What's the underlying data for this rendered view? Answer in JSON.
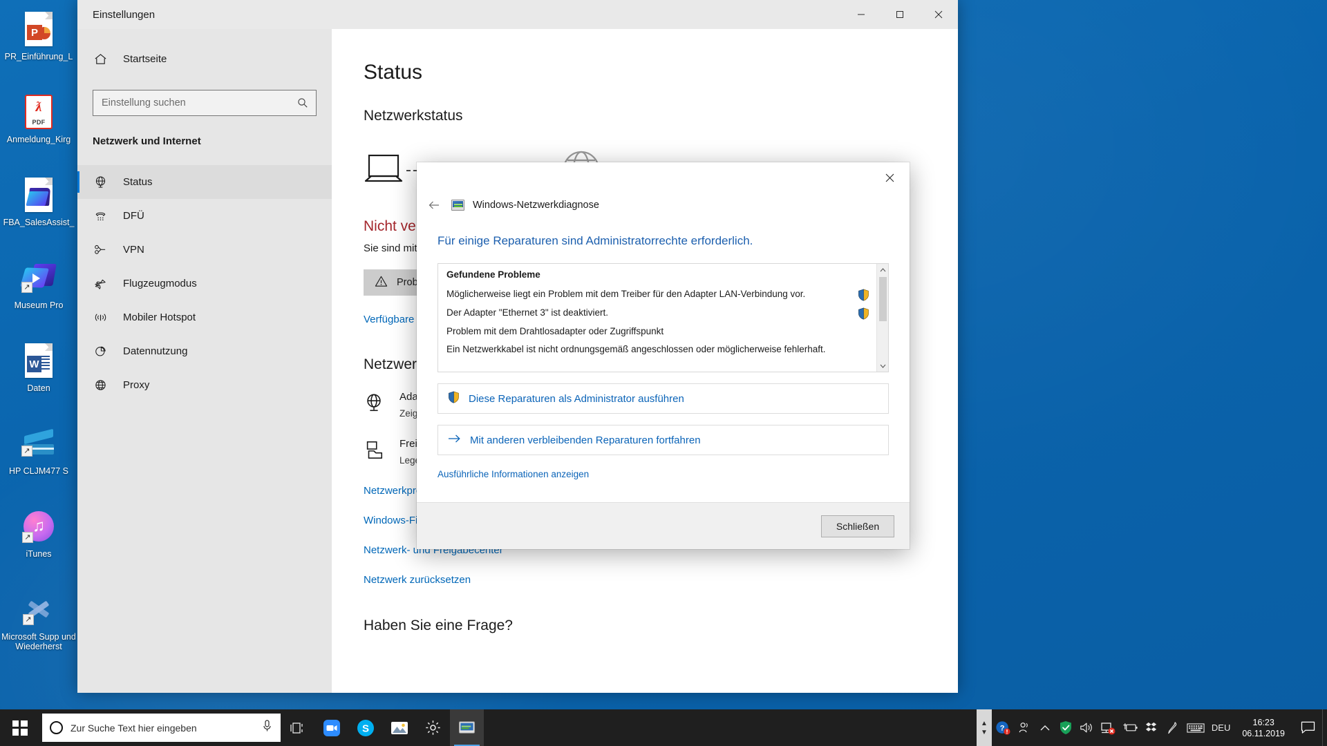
{
  "desktop": {
    "icons": [
      {
        "label": "PR_Einführung_L",
        "type": "powerpoint-file",
        "icon": "powerpoint-icon"
      },
      {
        "label": "Anmeldung_Kirg",
        "type": "pdf-file",
        "icon": "pdf-icon"
      },
      {
        "label": "FBA_SalesAssist_",
        "type": "folder-file",
        "icon": "blue-folder-icon"
      },
      {
        "label": "Museum Pro",
        "type": "shortcut",
        "icon": "museum-pro-icon"
      },
      {
        "label": "Daten",
        "type": "word-file",
        "icon": "word-icon"
      },
      {
        "label": "HP CLJM477 S",
        "type": "shortcut",
        "icon": "scanner-icon"
      },
      {
        "label": "iTunes",
        "type": "shortcut",
        "icon": "itunes-icon"
      },
      {
        "label": "Microsoft Supp und Wiederherst",
        "type": "shortcut",
        "icon": "support-recovery-icon"
      }
    ]
  },
  "settings_window": {
    "title": "Einstellungen",
    "titlebar": {
      "minimize_label": "─",
      "maximize_label": "□",
      "close_label": "✕"
    },
    "sidebar": {
      "home_label": "Startseite",
      "search": {
        "placeholder": "Einstellung suchen",
        "value": "",
        "icon": "search-icon"
      },
      "heading": "Netzwerk und Internet",
      "items": [
        {
          "label": "Status",
          "icon": "globe-icon",
          "active": true
        },
        {
          "label": "DFÜ",
          "icon": "dialup-phone-icon",
          "active": false
        },
        {
          "label": "VPN",
          "icon": "vpn-icon",
          "active": false
        },
        {
          "label": "Flugzeugmodus",
          "icon": "airplane-icon",
          "active": false
        },
        {
          "label": "Mobiler Hotspot",
          "icon": "hotspot-icon",
          "active": false
        },
        {
          "label": "Datennutzung",
          "icon": "pie-chart-icon",
          "active": false
        },
        {
          "label": "Proxy",
          "icon": "globe-icon",
          "active": false
        }
      ]
    },
    "main": {
      "page_title": "Status",
      "section_title": "Netzwerkstatus",
      "status_headline": "Nicht verbunden",
      "status_sub": "Sie sind mit keinem Netzwerk verbunden.",
      "troubleshoot_button": "Probleme behandeln",
      "troubleshoot_icon": "warning-icon",
      "available_networks_link": "Verfügbare Netzwerke anzeigen",
      "settings_section_title": "Netzwerkeinstellungen ändern",
      "settings_rows": [
        {
          "title": "Adapteroptionen ändern",
          "desc": "Zeigen Sie Netzwerkadapter an und ändern Sie die Verbindungseinstellungen.",
          "icon": "network-adapter-icon"
        },
        {
          "title": "Freigabeoptionen",
          "desc": "Legen Sie fest, was für die Netzwerke freigegeben werden soll, mit denen Sie eine Verbindung herstellen.",
          "icon": "sharing-icon"
        }
      ],
      "footer_links": [
        "Netzwerkproblembehandlung",
        "Windows-Firewall",
        "Netzwerk- und Freigabecenter",
        "Netzwerk zurücksetzen"
      ],
      "question_title": "Haben Sie eine Frage?"
    }
  },
  "diagnose_dialog": {
    "app_title": "Windows-Netzwerkdiagnose",
    "app_icon": "network-diagnostics-icon",
    "back_icon": "back-arrow-icon",
    "close_icon": "close-icon",
    "heading": "Für einige Reparaturen sind Administratorrechte erforderlich.",
    "problems_caption": "Gefundene Probleme",
    "problems": [
      {
        "text": "Möglicherweise liegt ein Problem mit dem Treiber für den Adapter LAN-Verbindung vor.",
        "admin": true
      },
      {
        "text": "Der Adapter \"Ethernet 3\" ist deaktiviert.",
        "admin": true
      },
      {
        "text": "Problem mit dem Drahtlosadapter oder Zugriffspunkt",
        "admin": false
      },
      {
        "text": "Ein Netzwerkkabel ist nicht ordnungsgemäß angeschlossen oder möglicherweise fehlerhaft.",
        "admin": false
      }
    ],
    "scroll_up_icon": "chevron-up-icon",
    "scroll_down_icon": "chevron-down-icon",
    "actions": [
      {
        "label": "Diese Reparaturen als Administrator ausführen",
        "icon": "shield-icon"
      },
      {
        "label": "Mit anderen verbleibenden Reparaturen fortfahren",
        "icon": "arrow-right-icon"
      }
    ],
    "details_link": "Ausführliche Informationen anzeigen",
    "close_button": "Schließen"
  },
  "taskbar": {
    "start_icon": "windows-logo-icon",
    "search": {
      "placeholder": "Zur Suche Text hier eingeben",
      "value": "",
      "cortana_icon": "cortana-circle-icon",
      "mic_icon": "microphone-icon"
    },
    "task_view_icon": "task-view-icon",
    "apps": [
      {
        "name": "zoom",
        "icon": "zoom-camera-icon",
        "active": false
      },
      {
        "name": "skype",
        "icon": "skype-icon",
        "active": false
      },
      {
        "name": "photos",
        "icon": "photos-icon",
        "active": false
      },
      {
        "name": "settings",
        "icon": "gear-icon",
        "active": false
      },
      {
        "name": "network-diagnostics",
        "icon": "network-diagnostics-icon",
        "active": true
      }
    ],
    "tray": {
      "expand_up_icon": "chevron-up-icon",
      "expand_down_icon": "chevron-down-icon",
      "items": [
        {
          "name": "help-alert",
          "icon": "question-mark-alert-icon"
        },
        {
          "name": "people",
          "icon": "people-icon"
        },
        {
          "name": "show-hidden",
          "icon": "chevron-up-icon"
        },
        {
          "name": "security",
          "icon": "shield-check-icon"
        },
        {
          "name": "volume",
          "icon": "speaker-icon"
        },
        {
          "name": "network-error",
          "icon": "network-error-icon"
        },
        {
          "name": "power",
          "icon": "battery-plug-icon"
        },
        {
          "name": "dropbox",
          "icon": "dropbox-icon"
        },
        {
          "name": "pen",
          "icon": "pen-icon"
        },
        {
          "name": "keyboard",
          "icon": "keyboard-icon"
        }
      ],
      "language": "DEU",
      "time": "16:23",
      "date": "06.11.2019",
      "action_center_icon": "speech-bubble-icon"
    }
  },
  "colors": {
    "accent": "#0078d7",
    "link": "#0067b8",
    "error": "#a4262c",
    "dialog_heading": "#1c5fae",
    "desktop": "#0a6ab5"
  }
}
